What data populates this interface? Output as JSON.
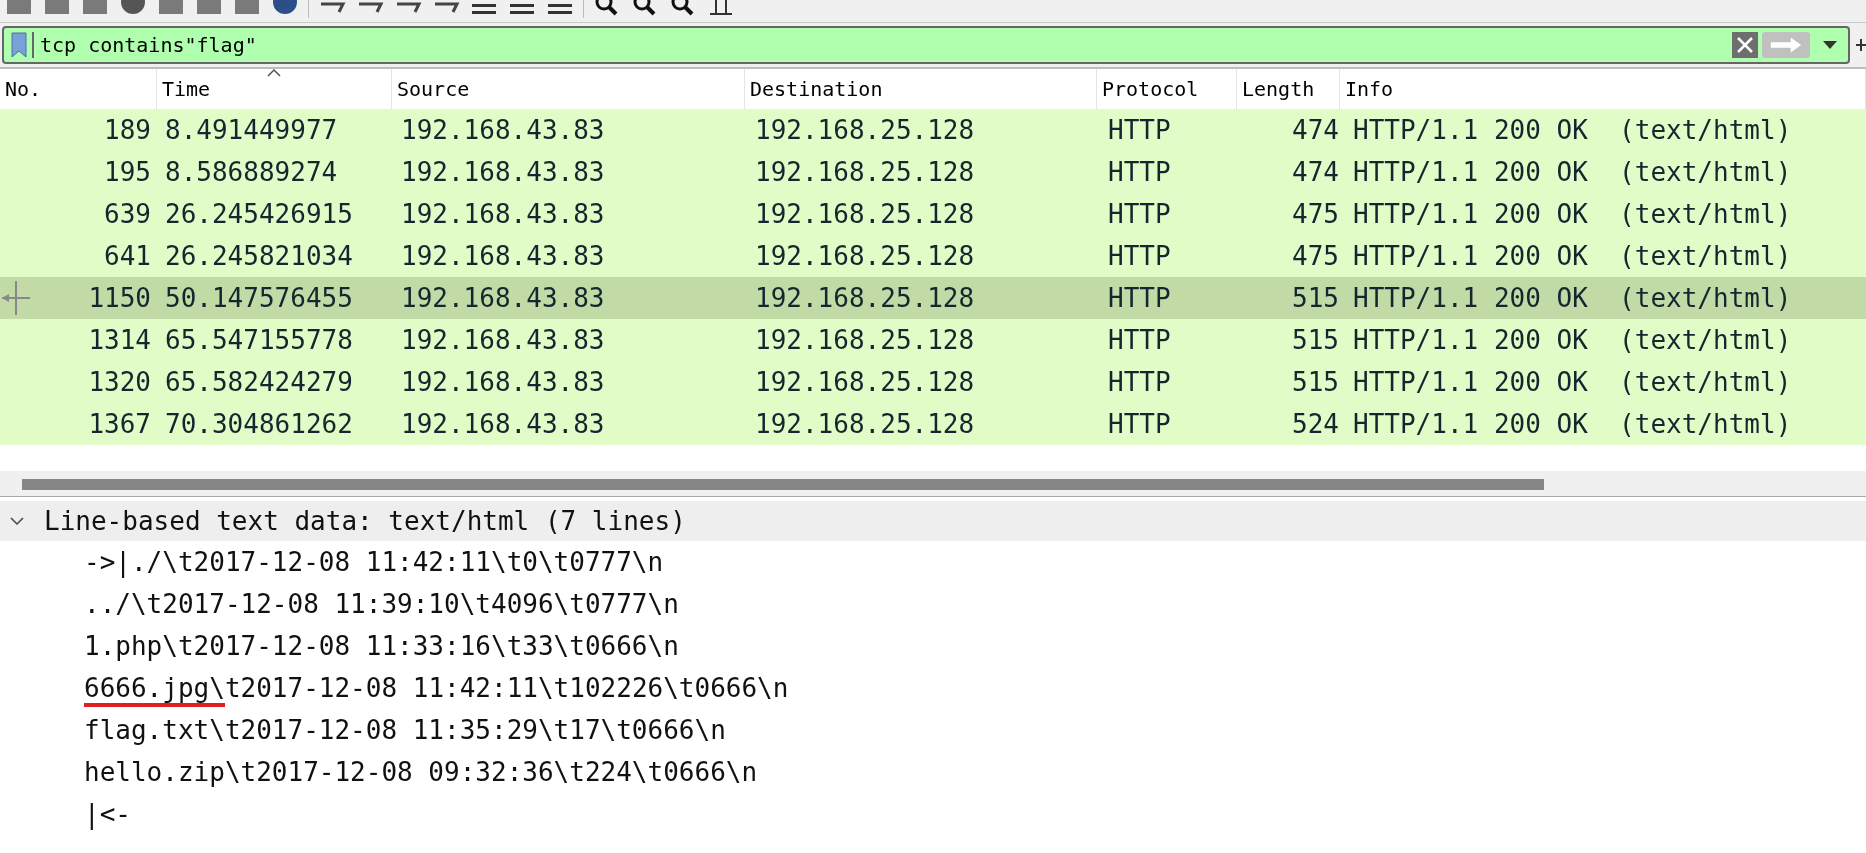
{
  "filter": {
    "value": "tcp contains\"flag\"",
    "valid": true
  },
  "columns": [
    {
      "label": "No.",
      "sorted": false
    },
    {
      "label": "Time",
      "sorted": true
    },
    {
      "label": "Source",
      "sorted": false
    },
    {
      "label": "Destination",
      "sorted": false
    },
    {
      "label": "Protocol",
      "sorted": false
    },
    {
      "label": "Length",
      "sorted": false
    },
    {
      "label": "Info",
      "sorted": false
    }
  ],
  "packets": [
    {
      "cells": [
        "189",
        "8.491449977",
        "192.168.43.83",
        "192.168.25.128",
        "HTTP",
        "474",
        "HTTP/1.1 200 OK  (text/html)"
      ],
      "selected": false
    },
    {
      "cells": [
        "195",
        "8.586889274",
        "192.168.43.83",
        "192.168.25.128",
        "HTTP",
        "474",
        "HTTP/1.1 200 OK  (text/html)"
      ],
      "selected": false
    },
    {
      "cells": [
        "639",
        "26.245426915",
        "192.168.43.83",
        "192.168.25.128",
        "HTTP",
        "475",
        "HTTP/1.1 200 OK  (text/html)"
      ],
      "selected": false
    },
    {
      "cells": [
        "641",
        "26.245821034",
        "192.168.43.83",
        "192.168.25.128",
        "HTTP",
        "475",
        "HTTP/1.1 200 OK  (text/html)"
      ],
      "selected": false
    },
    {
      "cells": [
        "1150",
        "50.147576455",
        "192.168.43.83",
        "192.168.25.128",
        "HTTP",
        "515",
        "HTTP/1.1 200 OK  (text/html)"
      ],
      "selected": true
    },
    {
      "cells": [
        "1314",
        "65.547155778",
        "192.168.43.83",
        "192.168.25.128",
        "HTTP",
        "515",
        "HTTP/1.1 200 OK  (text/html)"
      ],
      "selected": false
    },
    {
      "cells": [
        "1320",
        "65.582424279",
        "192.168.43.83",
        "192.168.25.128",
        "HTTP",
        "515",
        "HTTP/1.1 200 OK  (text/html)"
      ],
      "selected": false
    },
    {
      "cells": [
        "1367",
        "70.304861262",
        "192.168.43.83",
        "192.168.25.128",
        "HTTP",
        "524",
        "HTTP/1.1 200 OK  (text/html)"
      ],
      "selected": false
    }
  ],
  "details": {
    "label": "Line-based text data: text/html (7 lines)",
    "expanded": true,
    "children": [
      {
        "segments": [
          {
            "text": "->|./\\t2017-12-08 11:42:11\\t0\\t0777\\n",
            "underlined": false
          }
        ]
      },
      {
        "segments": [
          {
            "text": "../\\t2017-12-08 11:39:10\\t4096\\t0777\\n",
            "underlined": false
          }
        ]
      },
      {
        "segments": [
          {
            "text": "1.php\\t2017-12-08 11:33:16\\t33\\t0666\\n",
            "underlined": false
          }
        ]
      },
      {
        "segments": [
          {
            "text": "6666.jpg\\",
            "underlined": true
          },
          {
            "text": "t2017-12-08 11:42:11\\t102226\\t0666\\n",
            "underlined": false
          }
        ]
      },
      {
        "segments": [
          {
            "text": "flag.txt\\t2017-12-08 11:35:29\\t17\\t0666\\n",
            "underlined": false
          }
        ]
      },
      {
        "segments": [
          {
            "text": "hello.zip\\t2017-12-08 09:32:36\\t224\\t0666\\n",
            "underlined": false
          }
        ]
      },
      {
        "segments": [
          {
            "text": "|<-",
            "underlined": false
          }
        ]
      }
    ]
  }
}
